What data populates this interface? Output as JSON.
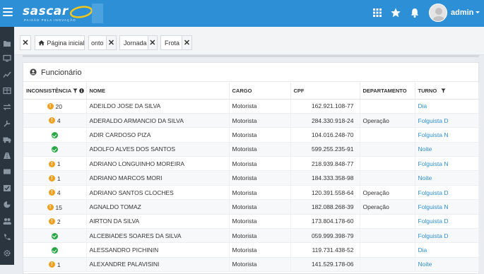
{
  "brand": {
    "name": "sascar",
    "tagline": "PAIXÃO PELA INOVAÇÃO"
  },
  "user": {
    "name": "admin"
  },
  "colors": {
    "topbar": "#2d8fd5",
    "sidebar": "#2a3540",
    "warning": "#f0a020",
    "ok": "#28a745",
    "link": "#2d8fd5"
  },
  "tabs": [
    {
      "label": "Página inicial",
      "icon": "home-icon"
    },
    {
      "label": "onto"
    },
    {
      "label": "Jornada"
    },
    {
      "label": "Frota"
    }
  ],
  "panel": {
    "title": "Funcionário"
  },
  "table": {
    "headers": {
      "inconsistencia": "INCONSISTÊNCIA",
      "nome": "NOME",
      "cargo": "CARGO",
      "cpf": "CPF",
      "departamento": "DEPARTAMENTO",
      "turno": "TURNO"
    },
    "rows": [
      {
        "status": "warn",
        "count": "20",
        "nome": "ADEILDO JOSE DA SILVA",
        "cargo": "Motorista",
        "cpf": "162.921.108-77",
        "departamento": "",
        "turno": "Dia"
      },
      {
        "status": "warn",
        "count": "4",
        "nome": "ADERALDO ARMANCIO DA SILVA",
        "cargo": "Motorista",
        "cpf": "284.330.918-24",
        "departamento": "Operação",
        "turno": "Folguista D"
      },
      {
        "status": "ok",
        "count": "",
        "nome": "ADIR CARDOSO PIZA",
        "cargo": "Motorista",
        "cpf": "104.016.248-70",
        "departamento": "",
        "turno": "Folguista N"
      },
      {
        "status": "ok",
        "count": "",
        "nome": "ADOLFO ALVES DOS SANTOS",
        "cargo": "Motorista",
        "cpf": "599.255.235-91",
        "departamento": "",
        "turno": "Noite"
      },
      {
        "status": "warn",
        "count": "1",
        "nome": "ADRIANO LONGUINHO MOREIRA",
        "cargo": "Motorista",
        "cpf": "218.939.848-77",
        "departamento": "",
        "turno": "Folguista N"
      },
      {
        "status": "warn",
        "count": "1",
        "nome": "ADRIANO MARCOS MORI",
        "cargo": "Motorista",
        "cpf": "184.333.358-98",
        "departamento": "",
        "turno": "Noite"
      },
      {
        "status": "warn",
        "count": "4",
        "nome": "ADRIANO SANTOS CLOCHES",
        "cargo": "Motorista",
        "cpf": "120.391.558-64",
        "departamento": "Operação",
        "turno": "Folguista D"
      },
      {
        "status": "warn",
        "count": "15",
        "nome": "AGNALDO TOMAZ",
        "cargo": "Motorista",
        "cpf": "182.088.268-39",
        "departamento": "Operação",
        "turno": "Folguista N"
      },
      {
        "status": "warn",
        "count": "2",
        "nome": "AIRTON DA SILVA",
        "cargo": "Motorista",
        "cpf": "173.804.178-60",
        "departamento": "",
        "turno": "Folguista D"
      },
      {
        "status": "ok",
        "count": "",
        "nome": "ALCEBIADES SOARES DA SILVA",
        "cargo": "Motorista",
        "cpf": "059.999.398-79",
        "departamento": "",
        "turno": "Folguista D"
      },
      {
        "status": "ok",
        "count": "",
        "nome": "ALESSANDRO PICHININ",
        "cargo": "Motorista",
        "cpf": "119.731.438-52",
        "departamento": "",
        "turno": "Dia"
      },
      {
        "status": "warn",
        "count": "1",
        "nome": "ALEXANDRE PALAVISINI",
        "cargo": "Motorista",
        "cpf": "141.529.178-06",
        "departamento": "",
        "turno": "Noite"
      }
    ]
  }
}
